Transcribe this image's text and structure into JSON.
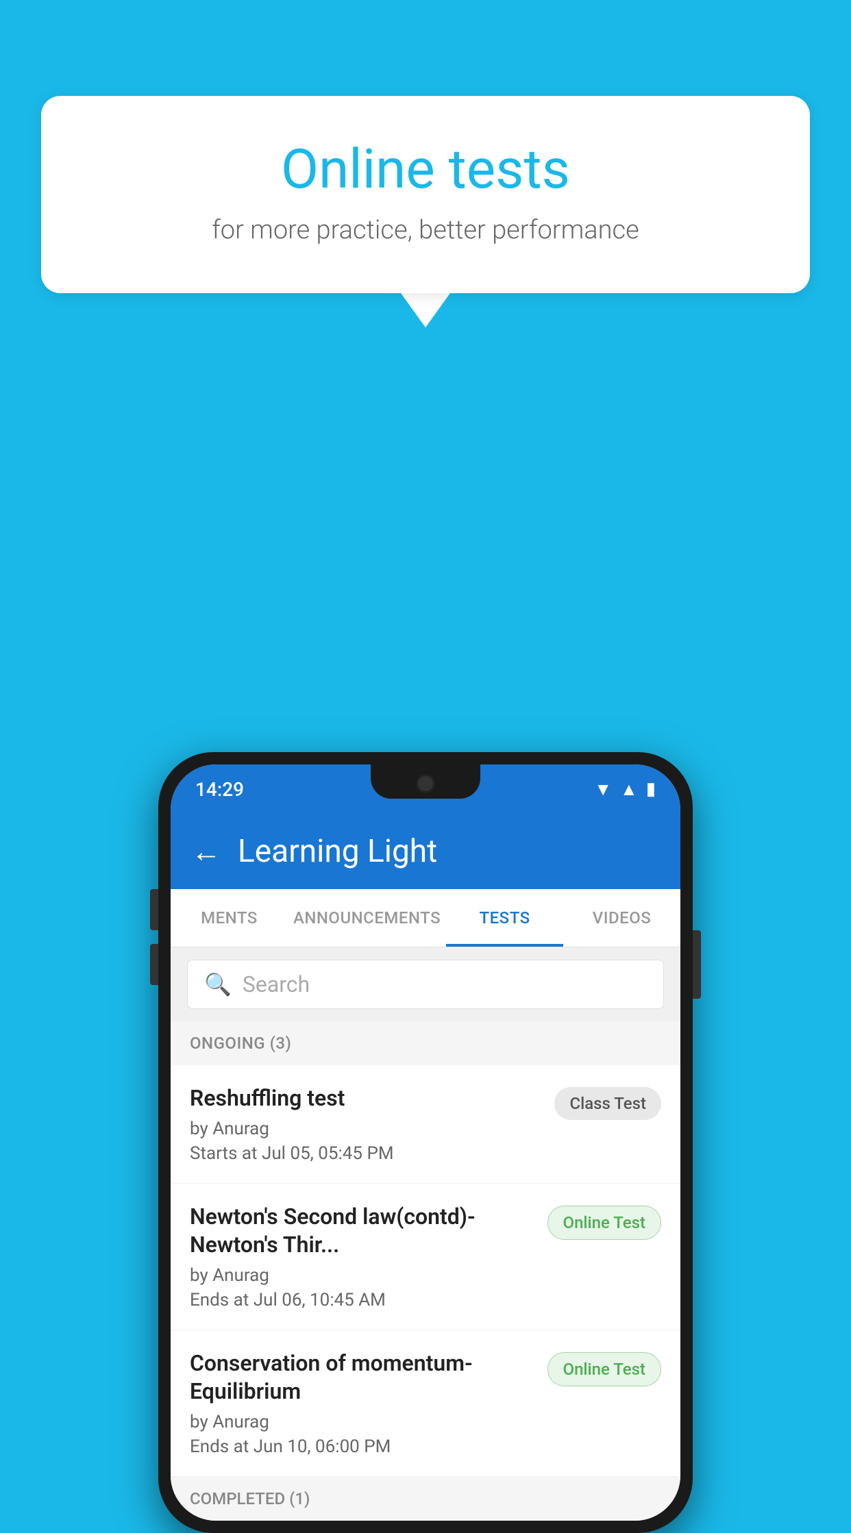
{
  "background_color": "#1ab8e8",
  "bubble": {
    "title": "Online tests",
    "subtitle": "for more practice, better performance"
  },
  "status_bar": {
    "time": "14:29",
    "icons": [
      "wifi",
      "signal",
      "battery"
    ]
  },
  "toolbar": {
    "title": "Learning Light",
    "back_label": "←"
  },
  "tabs": [
    {
      "label": "MENTS",
      "active": false
    },
    {
      "label": "ANNOUNCEMENTS",
      "active": false
    },
    {
      "label": "TESTS",
      "active": true
    },
    {
      "label": "VIDEOS",
      "active": false
    }
  ],
  "search": {
    "placeholder": "Search"
  },
  "sections": [
    {
      "header": "ONGOING (3)",
      "tests": [
        {
          "title": "Reshuffling test",
          "author": "by Anurag",
          "date": "Starts at  Jul 05, 05:45 PM",
          "badge": "Class Test",
          "badge_type": "class"
        },
        {
          "title": "Newton's Second law(contd)-Newton's Thir...",
          "author": "by Anurag",
          "date": "Ends at  Jul 06, 10:45 AM",
          "badge": "Online Test",
          "badge_type": "online"
        },
        {
          "title": "Conservation of momentum-Equilibrium",
          "author": "by Anurag",
          "date": "Ends at  Jun 10, 06:00 PM",
          "badge": "Online Test",
          "badge_type": "online"
        }
      ]
    },
    {
      "header": "COMPLETED (1)",
      "tests": []
    }
  ]
}
